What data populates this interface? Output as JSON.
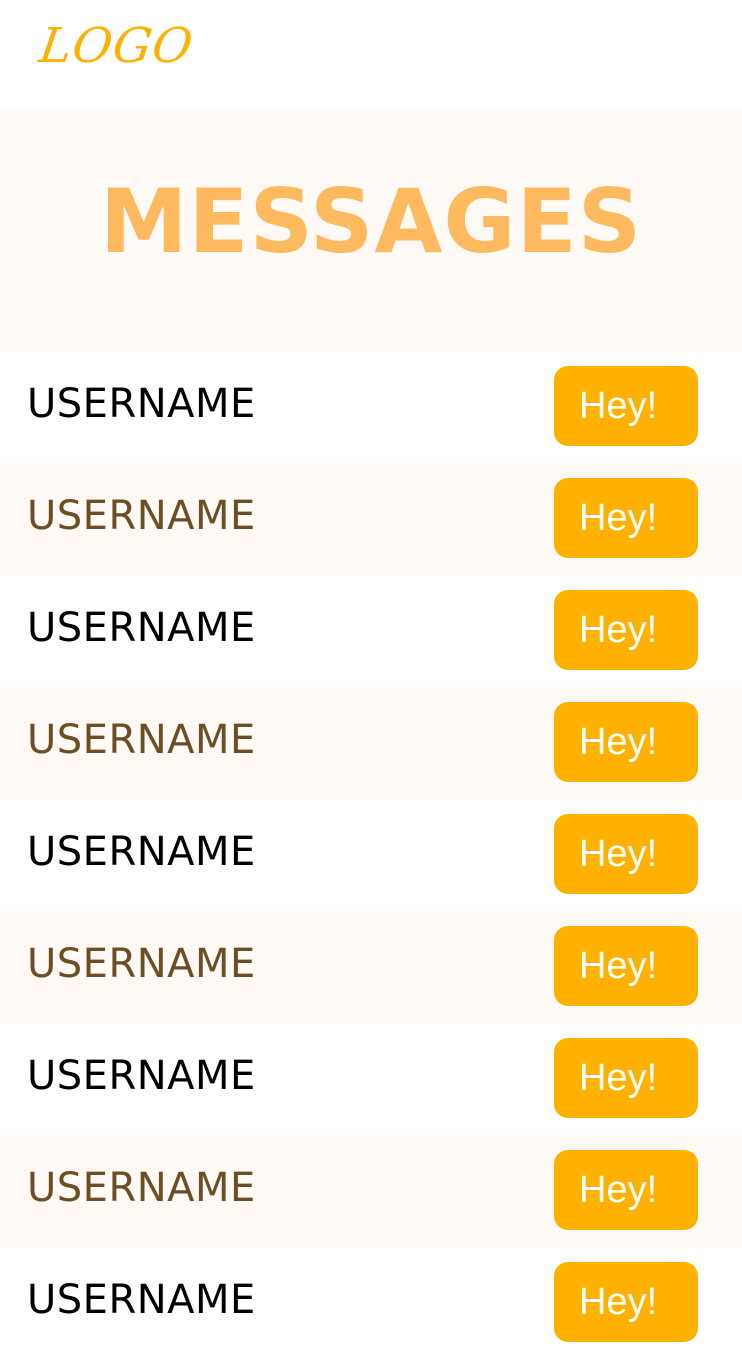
{
  "header": {
    "logo_text": "LOGO"
  },
  "hero": {
    "title": "MESSAGES"
  },
  "colors": {
    "accent": "#FFB100",
    "title": "#FFB95E",
    "row_alt_bg": "#FFFAF5",
    "username_dark": "#000000",
    "username_brown": "#6B4E23"
  },
  "messages": [
    {
      "username": "USERNAME",
      "reply_label": "Hey!"
    },
    {
      "username": "USERNAME",
      "reply_label": "Hey!"
    },
    {
      "username": "USERNAME",
      "reply_label": "Hey!"
    },
    {
      "username": "USERNAME",
      "reply_label": "Hey!"
    },
    {
      "username": "USERNAME",
      "reply_label": "Hey!"
    },
    {
      "username": "USERNAME",
      "reply_label": "Hey!"
    },
    {
      "username": "USERNAME",
      "reply_label": "Hey!"
    },
    {
      "username": "USERNAME",
      "reply_label": "Hey!"
    },
    {
      "username": "USERNAME",
      "reply_label": "Hey!"
    }
  ]
}
